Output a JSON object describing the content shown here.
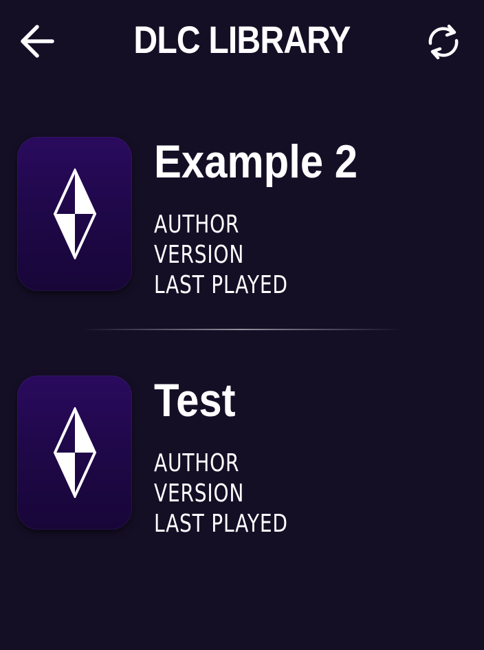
{
  "header": {
    "title": "DLC LIBRARY",
    "back_icon": "arrow-left-icon",
    "refresh_icon": "refresh-icon"
  },
  "colors": {
    "background": "#150f26",
    "thumb_top": "#2a0a5e",
    "thumb_bottom": "#180638",
    "text": "#ffffff"
  },
  "dlc_items": [
    {
      "name": "Example 2",
      "icon": "diamond-icon",
      "author_label": "AUTHOR",
      "version_label": "VERSION",
      "last_played_label": "LAST PLAYED"
    },
    {
      "name": "Test",
      "icon": "diamond-icon",
      "author_label": "AUTHOR",
      "version_label": "VERSION",
      "last_played_label": "LAST PLAYED"
    }
  ]
}
